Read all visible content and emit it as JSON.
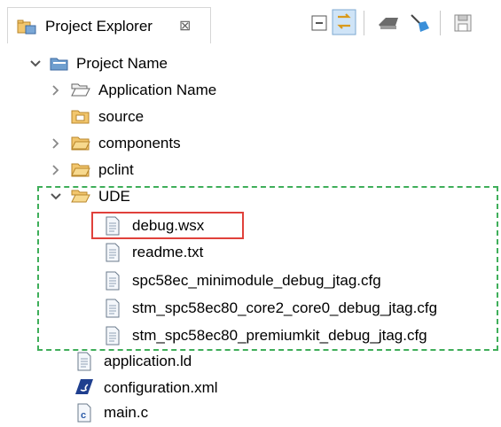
{
  "view": {
    "title": "Project Explorer",
    "close_glyph": "⊠"
  },
  "toolbar": {
    "buttons": [
      "collapse-all-icon",
      "link-with-editor-icon",
      "filter-icon",
      "clean-icon",
      "save-icon"
    ]
  },
  "tree": {
    "project": "Project Name",
    "items": [
      {
        "label": "Application Name",
        "icon": "open-folder-icon"
      },
      {
        "label": "source",
        "icon": "source-folder-icon"
      },
      {
        "label": "components",
        "icon": "folder-icon"
      },
      {
        "label": "pclint",
        "icon": "folder-icon"
      },
      {
        "label": "UDE",
        "icon": "open-folder-icon"
      },
      {
        "label": "debug.wsx",
        "icon": "file-icon"
      },
      {
        "label": "readme.txt",
        "icon": "file-icon"
      },
      {
        "label": "spc58ec_minimodule_debug_jtag.cfg",
        "icon": "file-icon"
      },
      {
        "label": "stm_spc58ec80_core2_core0_debug_jtag.cfg",
        "icon": "file-icon"
      },
      {
        "label": "stm_spc58ec80_premiumkit_debug_jtag.cfg",
        "icon": "file-icon"
      },
      {
        "label": "application.ld",
        "icon": "file-icon"
      },
      {
        "label": "configuration.xml",
        "icon": "st-logo-icon"
      },
      {
        "label": "main.c",
        "icon": "c-file-icon"
      }
    ]
  },
  "colors": {
    "highlight_box": "#e0413b",
    "group_box": "#3fae5a",
    "folder": "#e8b94a"
  }
}
